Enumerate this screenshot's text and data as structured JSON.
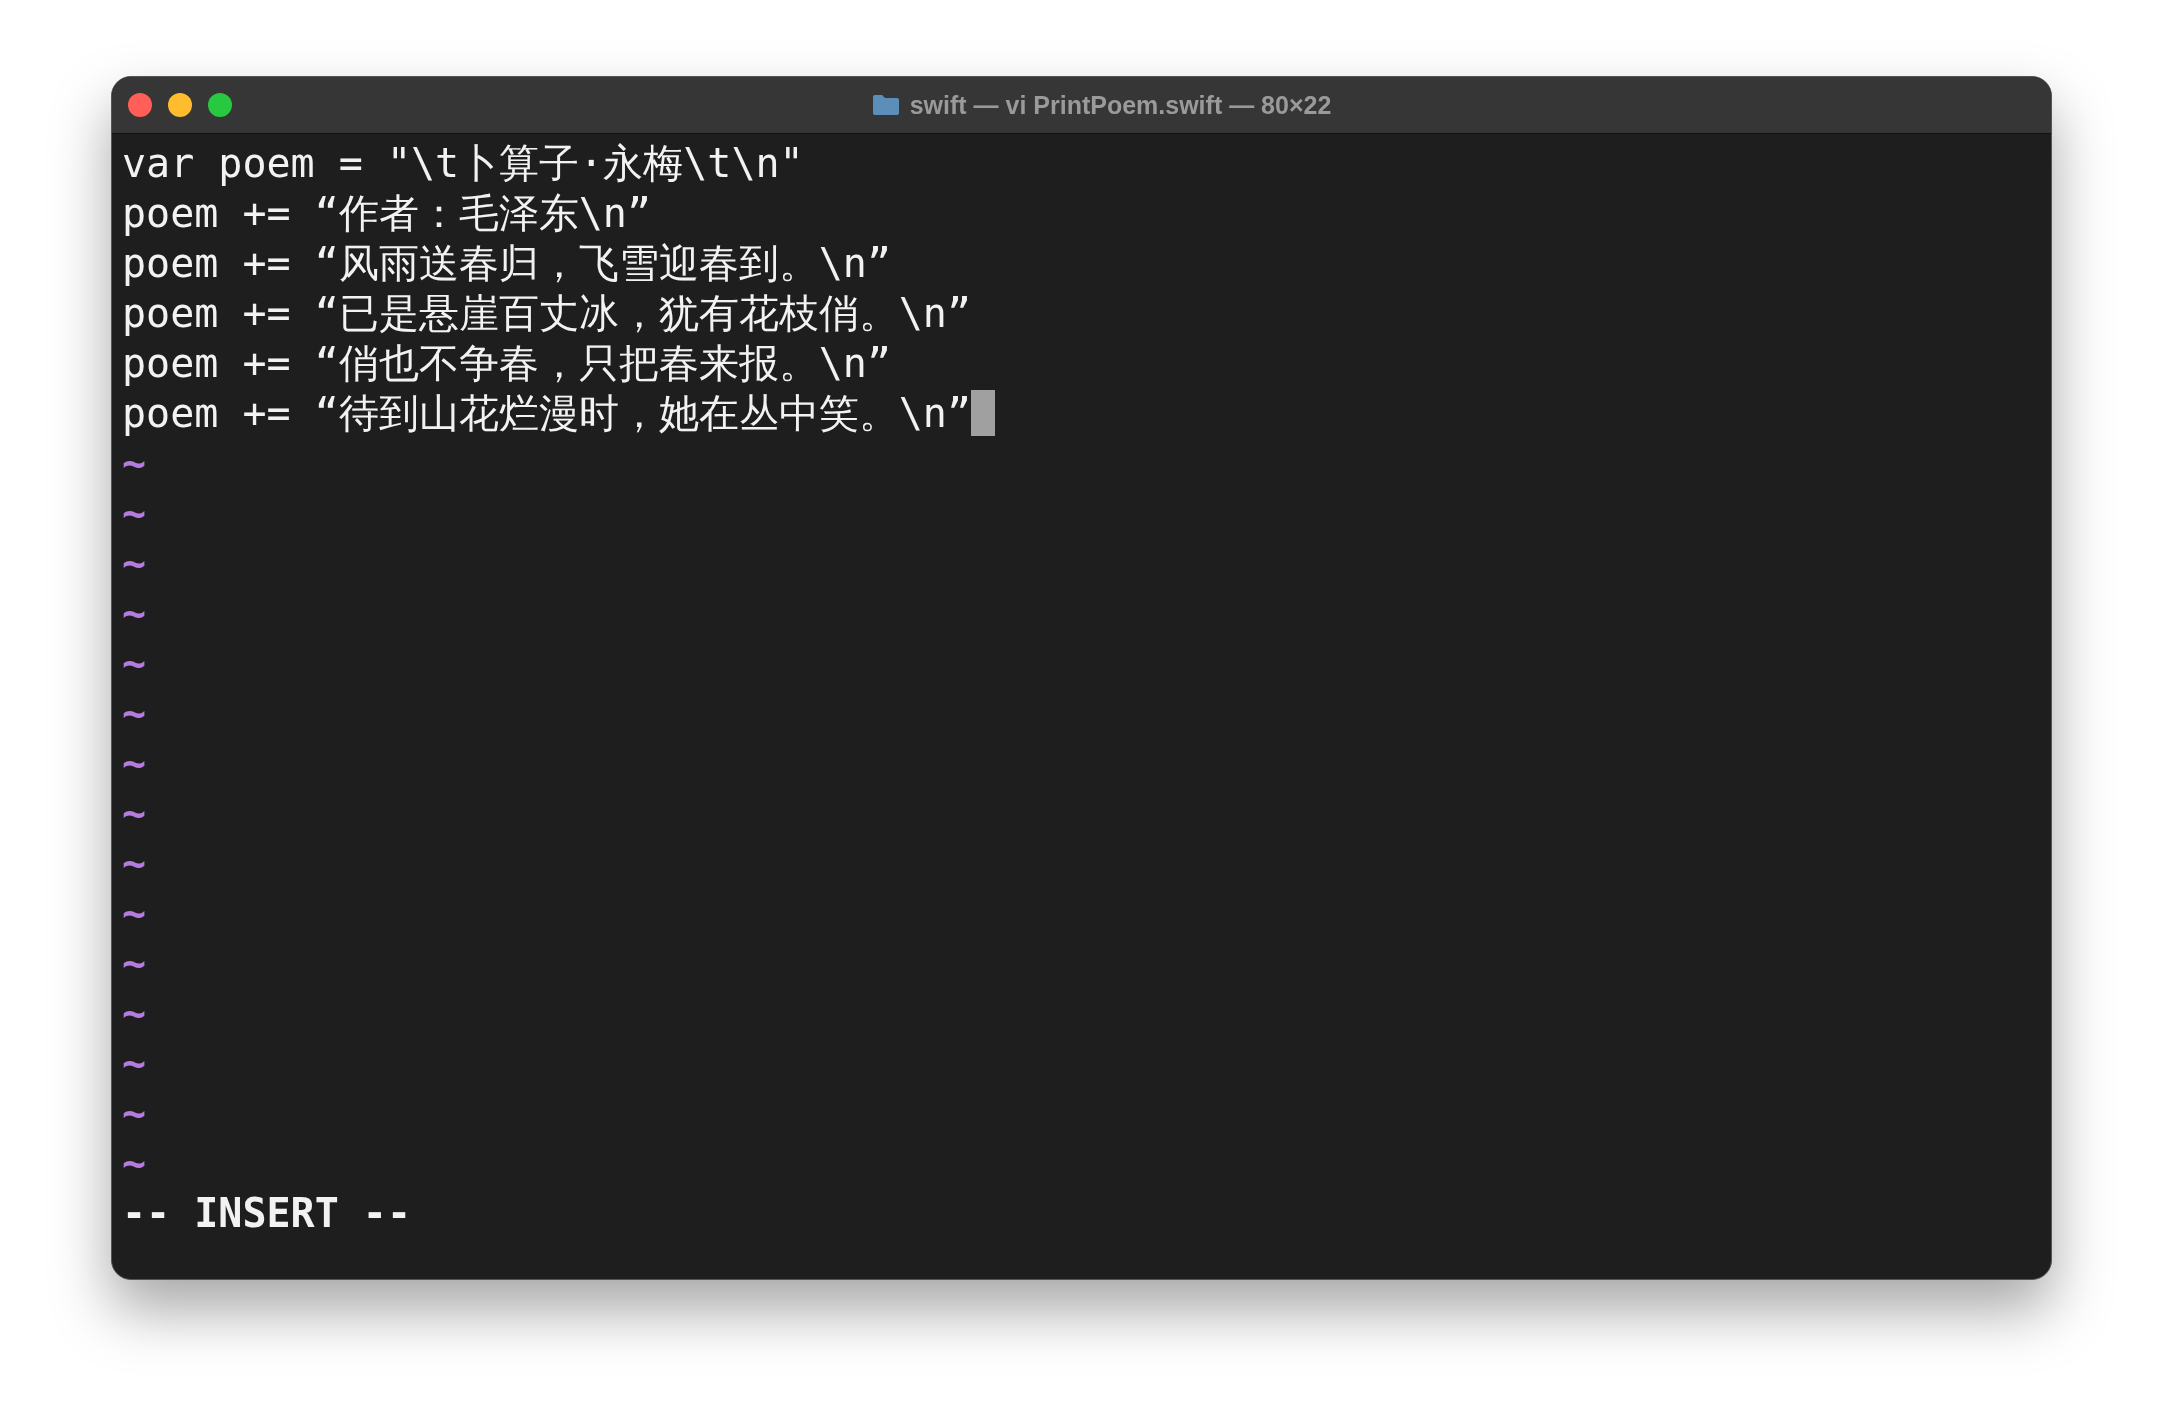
{
  "window": {
    "title": "swift — vi PrintPoem.swift — 80×22"
  },
  "lines": [
    {
      "text": "var poem = \"\\t卜算子·永梅\\t\\n\"",
      "cursor": false
    },
    {
      "text": "poem += “作者：毛泽东\\n”",
      "cursor": false
    },
    {
      "text": "poem += “风雨送春归，飞雪迎春到。\\n”",
      "cursor": false
    },
    {
      "text": "poem += “已是悬崖百丈冰，犹有花枝俏。\\n”",
      "cursor": false
    },
    {
      "text": "poem += “俏也不争春，只把春来报。\\n”",
      "cursor": false
    },
    {
      "text": "poem += “待到山花烂漫时，她在丛中笑。\\n”",
      "cursor": true
    }
  ],
  "empty_lines": [
    "~",
    "~",
    "~",
    "~",
    "~",
    "~",
    "~",
    "~",
    "~",
    "~",
    "~",
    "~",
    "~",
    "~",
    "~"
  ],
  "status_line": "-- INSERT --"
}
